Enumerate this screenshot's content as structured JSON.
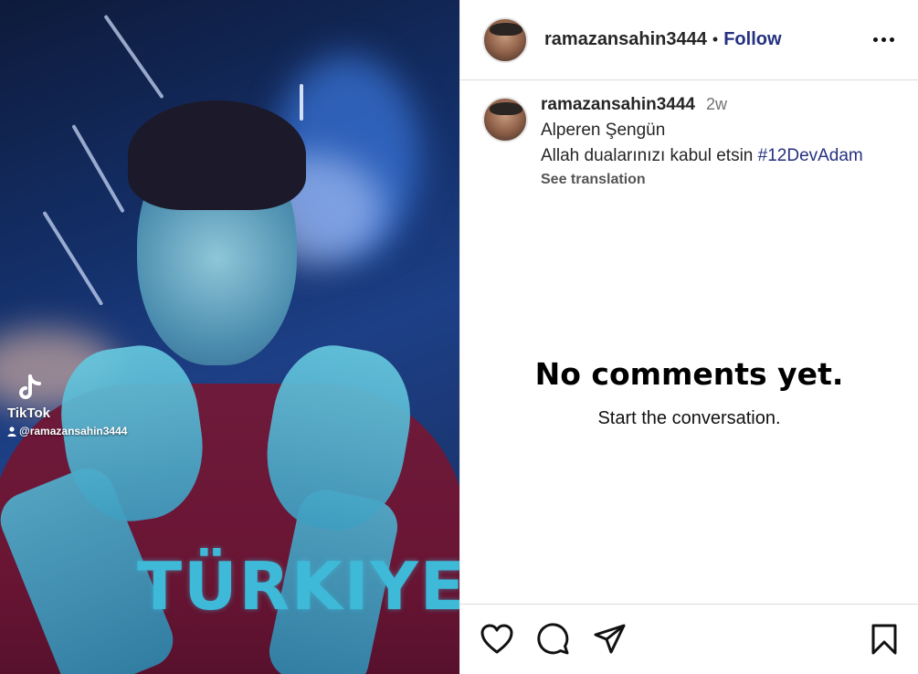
{
  "media": {
    "watermark_brand": "TikTok",
    "watermark_handle": "@ramazansahin3444",
    "shirt_text": "TÜRKIYE"
  },
  "header": {
    "username": "ramazansahin3444",
    "separator": "•",
    "follow_label": "Follow",
    "more_icon": "more-horizontal-icon"
  },
  "caption": {
    "username": "ramazansahin3444",
    "time": "2w",
    "line1": "Alperen Şengün",
    "line2_text": "Allah dualarınızı kabul etsin ",
    "hashtag": "#12DevAdam",
    "see_translation": "See translation"
  },
  "comments": {
    "empty_title": "No comments yet.",
    "empty_subtitle": "Start the conversation."
  },
  "actions": {
    "icons": [
      "heart-icon",
      "comment-icon",
      "share-icon",
      "bookmark-icon"
    ]
  },
  "colors": {
    "link": "#25317f",
    "text": "#262626",
    "muted": "#737373",
    "divider": "#dbdbdb"
  }
}
